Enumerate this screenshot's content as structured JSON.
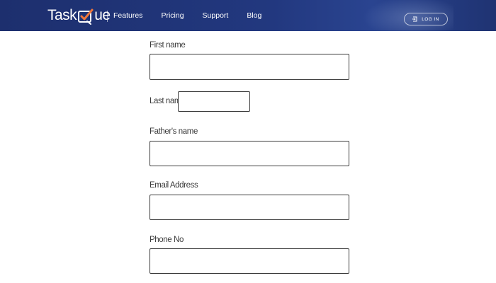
{
  "header": {
    "logo": {
      "text_before": "Task",
      "text_after": "ue",
      "accent_color": "#f0763b"
    },
    "nav": [
      {
        "label": "Features"
      },
      {
        "label": "Pricing"
      },
      {
        "label": "Support"
      },
      {
        "label": "Blog"
      }
    ],
    "login": {
      "label": "LOG IN",
      "icon": "login-icon"
    },
    "background_color": "#22387f"
  },
  "form": {
    "first_name": {
      "label": "First name",
      "value": "",
      "placeholder": ""
    },
    "last_name": {
      "label": "Last name",
      "value": "",
      "placeholder": ""
    },
    "fathers_name": {
      "label": "Father's name",
      "value": "",
      "placeholder": ""
    },
    "email": {
      "label": "Email Address",
      "value": "",
      "placeholder": ""
    },
    "phone": {
      "label": "Phone No",
      "value": "",
      "placeholder": ""
    }
  }
}
